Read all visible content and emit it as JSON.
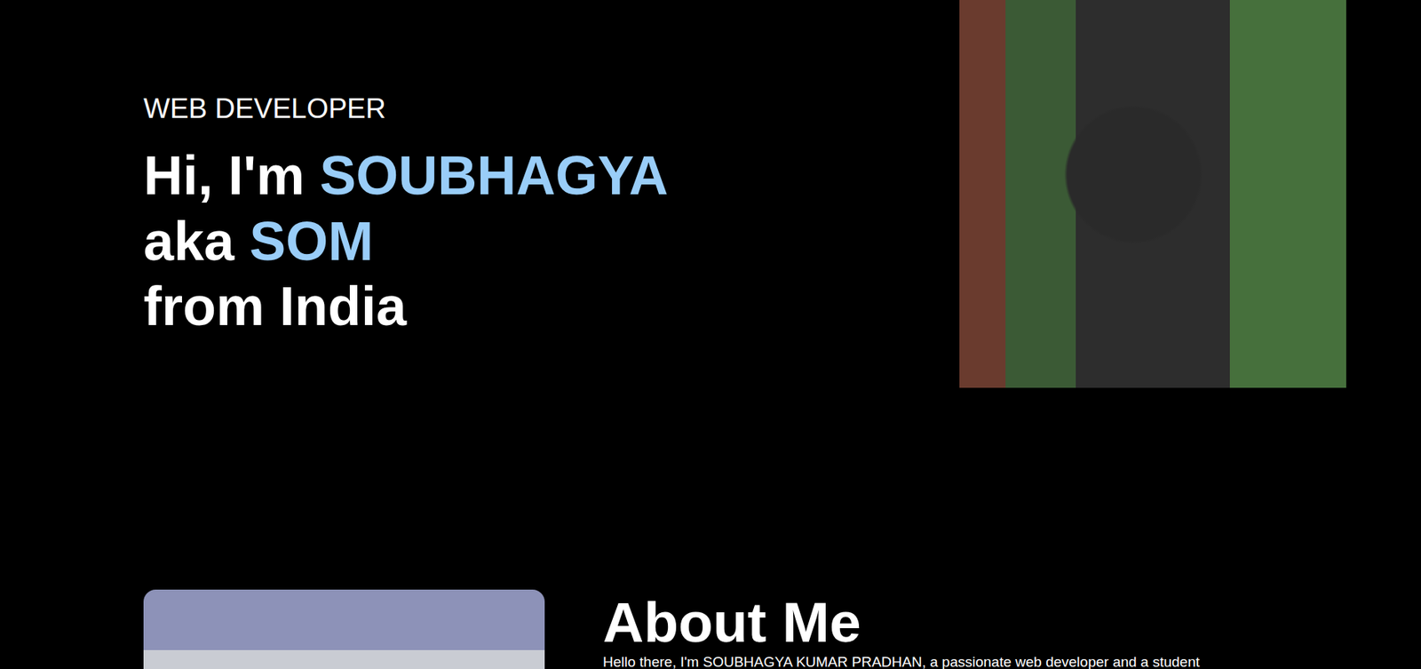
{
  "hero": {
    "role": "WEB DEVELOPER",
    "greeting": "Hi, I'm ",
    "name": "SOUBHAGYA",
    "aka": "aka ",
    "nickname": "SOM",
    "origin": "from India"
  },
  "about": {
    "title": "About Me",
    "text": "Hello there, I'm SOUBHAGYA KUMAR PRADHAN, a passionate web developer and a student"
  }
}
